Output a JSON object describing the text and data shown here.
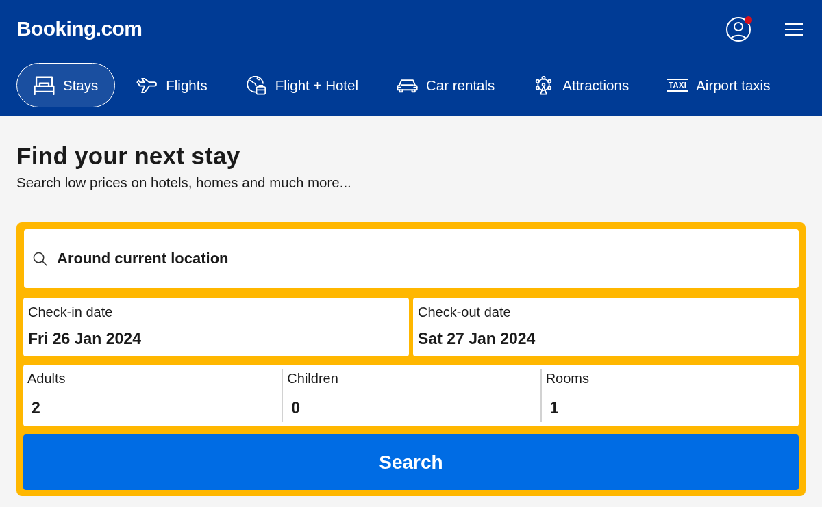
{
  "header": {
    "logo": "Booking.com",
    "account": {
      "notification": true
    },
    "tabs": [
      {
        "label": "Stays",
        "kind": "bed",
        "selected": true
      },
      {
        "label": "Flights",
        "kind": "plane",
        "selected": false
      },
      {
        "label": "Flight + Hotel",
        "kind": "globe-suitcase",
        "selected": false
      },
      {
        "label": "Car rentals",
        "kind": "car",
        "selected": false
      },
      {
        "label": "Attractions",
        "kind": "ferris-wheel",
        "selected": false
      },
      {
        "label": "Airport taxis",
        "kind": "taxi",
        "icon_text": "TAXI",
        "selected": false
      }
    ]
  },
  "intro": {
    "title": "Find your next stay",
    "subtitle": "Search low prices on hotels, homes and much more..."
  },
  "search_form": {
    "destination": {
      "value": "Around current location"
    },
    "dates": [
      {
        "label": "Check-in date",
        "value": "Fri 26 Jan 2024"
      },
      {
        "label": "Check-out date",
        "value": "Sat 27 Jan 2024"
      }
    ],
    "occupancy": [
      {
        "label": "Adults",
        "value": "2"
      },
      {
        "label": "Children",
        "value": "0"
      },
      {
        "label": "Rooms",
        "value": "1"
      }
    ],
    "submit": "Search"
  }
}
